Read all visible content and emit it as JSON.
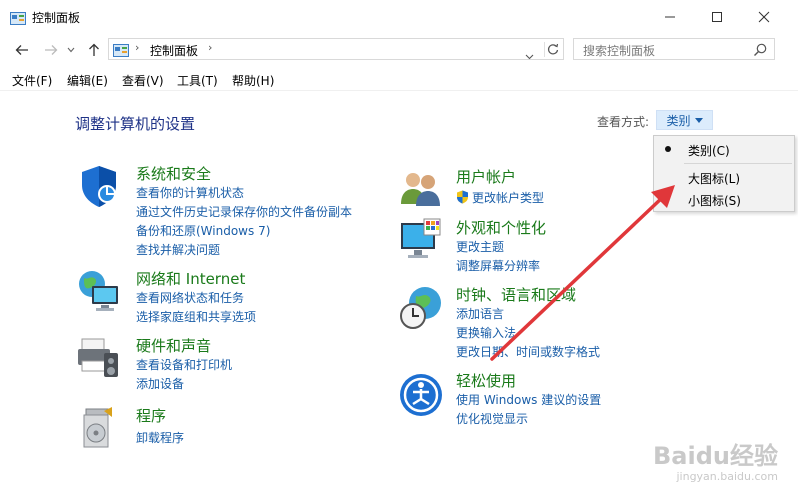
{
  "window": {
    "title": "控制面板"
  },
  "address": {
    "path": "控制面板"
  },
  "search": {
    "placeholder": "搜索控制面板"
  },
  "menu": [
    "文件(F)",
    "编辑(E)",
    "查看(V)",
    "工具(T)",
    "帮助(H)"
  ],
  "heading": "调整计算机的设置",
  "view": {
    "label": "查看方式:",
    "selected": "类别"
  },
  "dropdown": {
    "options": [
      "类别(C)",
      "大图标(L)",
      "小图标(S)"
    ],
    "checked_index": 0
  },
  "categories_left": [
    {
      "title": "系统和安全",
      "links": [
        "查看你的计算机状态",
        "通过文件历史记录保存你的文件备份副本",
        "备份和还原(Windows 7)",
        "查找并解决问题"
      ]
    },
    {
      "title": "网络和 Internet",
      "links": [
        "查看网络状态和任务",
        "选择家庭组和共享选项"
      ]
    },
    {
      "title": "硬件和声音",
      "links": [
        "查看设备和打印机",
        "添加设备"
      ]
    },
    {
      "title": "程序",
      "links": [
        "卸载程序"
      ]
    }
  ],
  "categories_right": [
    {
      "title": "用户帐户",
      "links": [
        "更改帐户类型"
      ]
    },
    {
      "title": "外观和个性化",
      "links": [
        "更改主题",
        "调整屏幕分辨率"
      ]
    },
    {
      "title": "时钟、语言和区域",
      "links": [
        "添加语言",
        "更换输入法",
        "更改日期、时间或数字格式"
      ]
    },
    {
      "title": "轻松使用",
      "links": [
        "使用 Windows 建议的设置",
        "优化视觉显示"
      ]
    }
  ],
  "watermark": {
    "brand": "Baidu经验",
    "url": "jingyan.baidu.com"
  },
  "colors": {
    "heading": "#1e3287",
    "category": "#1a7a1a",
    "link": "#1a5ea8",
    "arrow": "#e0373a"
  }
}
